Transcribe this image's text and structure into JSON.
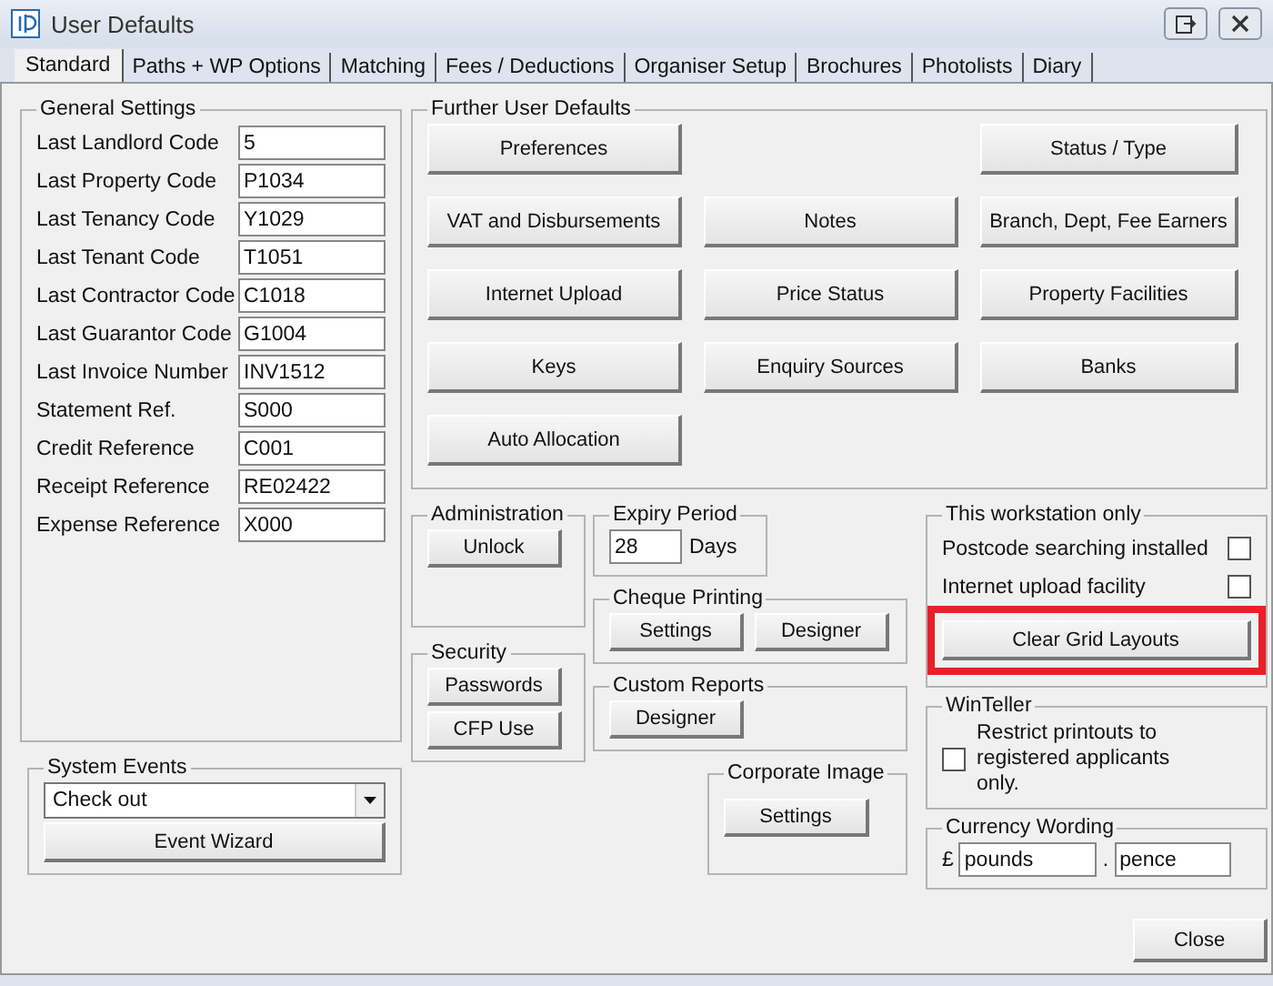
{
  "window": {
    "title": "User Defaults"
  },
  "tabs": [
    {
      "label": "Standard",
      "selected": true
    },
    {
      "label": "Paths + WP Options",
      "selected": false
    },
    {
      "label": "Matching",
      "selected": false
    },
    {
      "label": "Fees / Deductions",
      "selected": false
    },
    {
      "label": "Organiser Setup",
      "selected": false
    },
    {
      "label": "Brochures",
      "selected": false
    },
    {
      "label": "Photolists",
      "selected": false
    },
    {
      "label": "Diary",
      "selected": false
    }
  ],
  "general_settings": {
    "title": "General Settings",
    "fields": [
      {
        "label": "Last Landlord Code",
        "value": "5"
      },
      {
        "label": "Last Property Code",
        "value": "P1034"
      },
      {
        "label": "Last Tenancy Code",
        "value": "Y1029"
      },
      {
        "label": "Last Tenant Code",
        "value": "T1051"
      },
      {
        "label": "Last Contractor Code",
        "value": "C1018"
      },
      {
        "label": "Last Guarantor Code",
        "value": "G1004"
      },
      {
        "label": "Last Invoice Number",
        "value": "INV1512"
      },
      {
        "label": "Statement Ref.",
        "value": "S000"
      },
      {
        "label": "Credit Reference",
        "value": "C001"
      },
      {
        "label": "Receipt Reference",
        "value": "RE02422"
      },
      {
        "label": "Expense Reference",
        "value": "X000"
      }
    ]
  },
  "system_events": {
    "title": "System Events",
    "dropdown": "Check out",
    "button": "Event Wizard"
  },
  "further_user_defaults": {
    "title": "Further User Defaults",
    "rows": [
      [
        "Preferences",
        null,
        "Status / Type"
      ],
      [
        "VAT and Disbursements",
        "Notes",
        "Branch, Dept, Fee Earners"
      ],
      [
        "Internet Upload",
        "Price Status",
        "Property Facilities"
      ],
      [
        "Keys",
        "Enquiry Sources",
        "Banks"
      ],
      [
        "Auto Allocation",
        null,
        null
      ]
    ]
  },
  "administration": {
    "title": "Administration",
    "button": "Unlock"
  },
  "security": {
    "title": "Security",
    "buttons": [
      "Passwords",
      "CFP Use"
    ]
  },
  "expiry_period": {
    "title": "Expiry Period",
    "value": "28",
    "unit": "Days"
  },
  "cheque_printing": {
    "title": "Cheque Printing",
    "buttons": [
      "Settings",
      "Designer"
    ]
  },
  "custom_reports": {
    "title": "Custom Reports",
    "button": "Designer"
  },
  "corporate_image": {
    "title": "Corporate Image",
    "button": "Settings"
  },
  "workstation": {
    "title": "This workstation only",
    "options": [
      {
        "label": "Postcode searching installed",
        "checked": false
      },
      {
        "label": "Internet upload facility",
        "checked": false
      }
    ],
    "button": "Clear Grid Layouts"
  },
  "winteller": {
    "title": "WinTeller",
    "label": "Restrict printouts to registered applicants only.",
    "checked": false
  },
  "currency_wording": {
    "title": "Currency Wording",
    "symbol": "£",
    "major": "pounds",
    "separator": ".",
    "minor": "pence"
  },
  "close_button": "Close"
}
